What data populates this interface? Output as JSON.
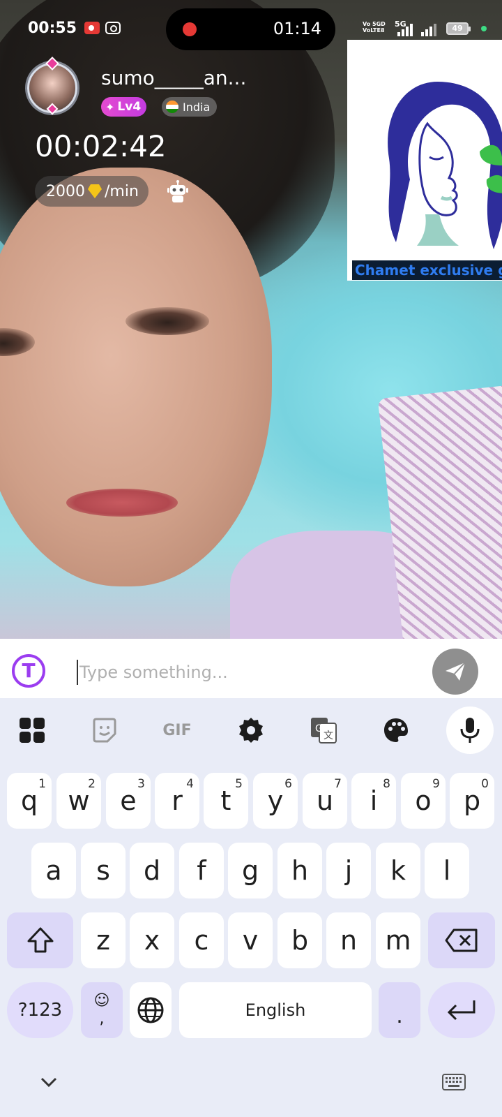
{
  "status_bar": {
    "time": "00:55",
    "network_label_1": "Vo 5GD\nVoLTE8",
    "network_label_2": "5G",
    "battery": "49"
  },
  "call": {
    "call_timer": "01:14",
    "username": "sumo_____an...",
    "level": "Lv4",
    "country": "India",
    "duration": "00:02:42",
    "rate_value": "2000",
    "rate_unit": "/min"
  },
  "ad": {
    "caption": "Chamet exclusive gro"
  },
  "input": {
    "placeholder": "Type something..."
  },
  "keyboard": {
    "toolbar": [
      "apps-icon",
      "sticker-icon",
      "gif-icon",
      "settings-icon",
      "translate-icon",
      "palette-icon",
      "mic-icon"
    ],
    "gif_label": "GIF",
    "row1": [
      {
        "key": "q",
        "hint": "1"
      },
      {
        "key": "w",
        "hint": "2"
      },
      {
        "key": "e",
        "hint": "3"
      },
      {
        "key": "r",
        "hint": "4"
      },
      {
        "key": "t",
        "hint": "5"
      },
      {
        "key": "y",
        "hint": "6"
      },
      {
        "key": "u",
        "hint": "7"
      },
      {
        "key": "i",
        "hint": "8"
      },
      {
        "key": "o",
        "hint": "9"
      },
      {
        "key": "p",
        "hint": "0"
      }
    ],
    "row2": [
      "a",
      "s",
      "d",
      "f",
      "g",
      "h",
      "j",
      "k",
      "l"
    ],
    "row3": [
      "z",
      "x",
      "c",
      "v",
      "b",
      "n",
      "m"
    ],
    "sym_label": "?123",
    "emoji_comma": ",",
    "space_label": "English",
    "period": "."
  }
}
